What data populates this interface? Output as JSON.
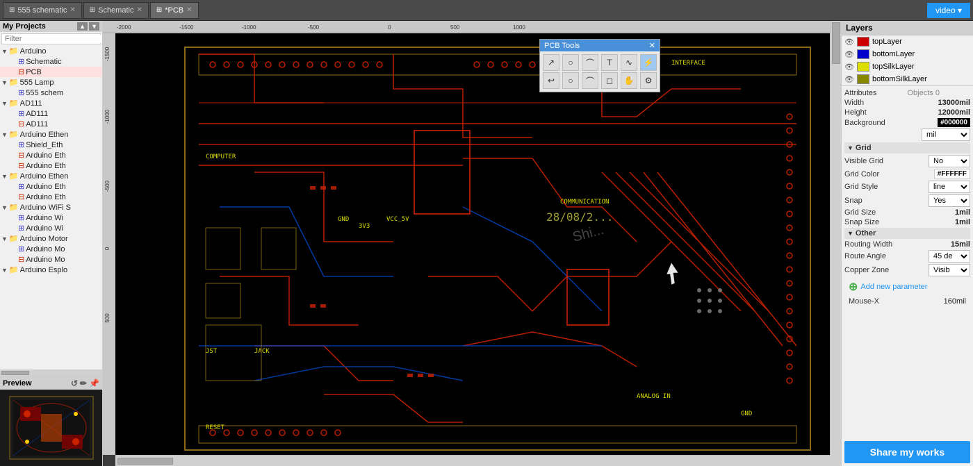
{
  "topbar": {
    "tabs": [
      {
        "id": "tab-555schematic",
        "label": "555 schematic",
        "icon": "⊞",
        "active": false,
        "closable": true
      },
      {
        "id": "tab-schematic",
        "label": "Schematic",
        "icon": "⊞",
        "active": false,
        "closable": true
      },
      {
        "id": "tab-pcb",
        "label": "*PCB",
        "icon": "⊞",
        "active": true,
        "closable": true
      }
    ],
    "video_btn": "video ▾"
  },
  "sidebar": {
    "header": "My Projects",
    "filter_placeholder": "Filter",
    "tree": [
      {
        "level": 0,
        "type": "folder",
        "label": "Arduino",
        "expanded": true
      },
      {
        "level": 1,
        "type": "schematic",
        "label": "Schematic"
      },
      {
        "level": 1,
        "type": "pcb",
        "label": "PCB"
      },
      {
        "level": 0,
        "type": "folder",
        "label": "555 Lamp",
        "expanded": true
      },
      {
        "level": 1,
        "type": "schematic",
        "label": "555 schem"
      },
      {
        "level": 0,
        "type": "folder",
        "label": "AD111",
        "expanded": true
      },
      {
        "level": 1,
        "type": "schematic",
        "label": "AD111"
      },
      {
        "level": 1,
        "type": "pcb",
        "label": "AD111"
      },
      {
        "level": 0,
        "type": "folder",
        "label": "Arduino Ethen",
        "expanded": true
      },
      {
        "level": 1,
        "type": "schematic",
        "label": "Shield_Eth"
      },
      {
        "level": 1,
        "type": "pcb",
        "label": "Arduino Eth"
      },
      {
        "level": 1,
        "type": "pcb",
        "label": "Arduino Eth"
      },
      {
        "level": 0,
        "type": "folder",
        "label": "Arduino Ethen",
        "expanded": true
      },
      {
        "level": 1,
        "type": "schematic",
        "label": "Arduino Eth"
      },
      {
        "level": 1,
        "type": "pcb",
        "label": "Arduino Eth"
      },
      {
        "level": 0,
        "type": "folder",
        "label": "Arduino WiFi S",
        "expanded": true
      },
      {
        "level": 1,
        "type": "schematic",
        "label": "Arduino Wi"
      },
      {
        "level": 1,
        "type": "schematic",
        "label": "Arduino Wi"
      },
      {
        "level": 0,
        "type": "folder",
        "label": "Arduino Motor",
        "expanded": true
      },
      {
        "level": 1,
        "type": "schematic",
        "label": "Arduino Mo"
      },
      {
        "level": 1,
        "type": "pcb",
        "label": "Arduino Mo"
      },
      {
        "level": 0,
        "type": "folder",
        "label": "Arduino Esplo",
        "expanded": true
      }
    ],
    "preview_label": "Preview"
  },
  "pcb_tools": {
    "title": "PCB Tools",
    "tools": [
      {
        "icon": "↗",
        "name": "select"
      },
      {
        "icon": "○",
        "name": "circle"
      },
      {
        "icon": "⌒",
        "name": "arc"
      },
      {
        "icon": "T",
        "name": "text"
      },
      {
        "icon": "∿",
        "name": "wave"
      },
      {
        "icon": "⚡",
        "name": "power"
      },
      {
        "icon": "↩",
        "name": "undo"
      },
      {
        "icon": "○",
        "name": "oval"
      },
      {
        "icon": "⌒",
        "name": "arc2"
      },
      {
        "icon": "◻",
        "name": "rect"
      },
      {
        "icon": "✋",
        "name": "hand"
      },
      {
        "icon": "⚙",
        "name": "settings"
      }
    ]
  },
  "right_panel": {
    "layers_title": "Layers",
    "layers": [
      {
        "name": "topLayer",
        "color": "#CC0000",
        "visible": true
      },
      {
        "name": "bottomLayer",
        "color": "#0000CC",
        "visible": true
      },
      {
        "name": "topSilkLayer",
        "color": "#DDDD00",
        "visible": true
      },
      {
        "name": "bottomSilkLayer",
        "color": "#888800",
        "visible": true
      }
    ],
    "attributes_label": "Attributes",
    "objects_label": "Objects",
    "objects_value": "0",
    "width_label": "Width",
    "width_value": "13000mil",
    "height_label": "Height",
    "height_value": "12000mil",
    "background_label": "Background",
    "background_value": "#000000",
    "grid_section": "Grid",
    "visible_grid_label": "Visible Grid",
    "visible_grid_value": "No",
    "grid_color_label": "Grid Color",
    "grid_color_value": "#FFFFFF",
    "grid_style_label": "Grid Style",
    "grid_style_value": "line",
    "snap_label": "Snap",
    "snap_value": "Yes",
    "grid_size_label": "Grid Size",
    "grid_size_value": "1mil",
    "snap_size_label": "Snap Size",
    "snap_size_value": "1mil",
    "other_section": "Other",
    "routing_width_label": "Routing Width",
    "routing_width_value": "15mil",
    "route_angle_label": "Route Angle",
    "route_angle_value": "45 de",
    "copper_zone_label": "Copper Zone",
    "copper_zone_value": "Visib",
    "add_param_label": "Add new parameter",
    "mouse_x_label": "Mouse-X",
    "mouse_x_value": "160mil",
    "share_btn": "Share my works",
    "unit_label": "mil"
  },
  "ruler": {
    "h_marks": [
      "-2000",
      "-1500",
      "-1000",
      "-500",
      "0",
      "500",
      "1000"
    ],
    "v_marks": [
      "-1500",
      "-1000",
      "-500",
      "0",
      "500"
    ]
  }
}
